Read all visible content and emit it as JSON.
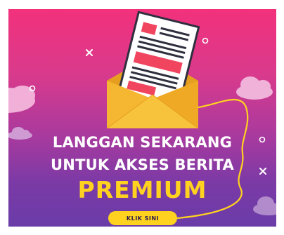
{
  "banner": {
    "headline_line1": "LANGGAN SEKARANG",
    "headline_line2": "UNTUK AKSES BERITA",
    "highlight": "PREMIUM",
    "cta_label": "KLIK SINI"
  },
  "colors": {
    "gradient_top": "#f2317c",
    "gradient_bottom": "#6a3ca8",
    "accent_yellow": "#ffd21f",
    "envelope": "#f5b731",
    "newspaper_red": "#f0445f"
  },
  "icons": [
    "envelope-icon",
    "newspaper-icon",
    "cloud-icon",
    "sparkle-x-icon",
    "sparkle-circle-icon",
    "cord-line"
  ]
}
